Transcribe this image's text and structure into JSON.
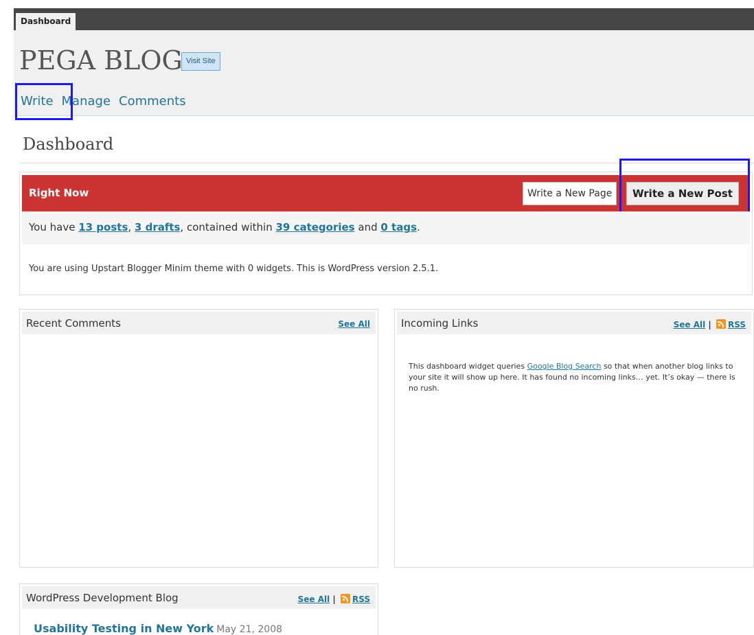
{
  "topbar": {
    "tab": "Dashboard"
  },
  "header": {
    "blog_title": "PEGA BLOG",
    "visit_site": "Visit Site",
    "nav": [
      "Write",
      "Manage",
      "Comments"
    ]
  },
  "page_title": "Dashboard",
  "right_now": {
    "title": "Right Now",
    "write_page": "Write a New Page",
    "write_post": "Write a New Post",
    "summary_prefix": "You have ",
    "posts": "13 posts",
    "comma": ", ",
    "drafts": "3 drafts",
    "mid": ", contained within ",
    "categories": "39 categories",
    "and": " and ",
    "tags": "0 tags",
    "end": ".",
    "theme_line": "You are using Upstart Blogger Minim theme with 0 widgets. This is WordPress version 2.5.1."
  },
  "recent_comments": {
    "title": "Recent Comments",
    "see_all": "See All"
  },
  "incoming_links": {
    "title": "Incoming Links",
    "see_all": "See All",
    "sep": " | ",
    "rss": "RSS",
    "body_prefix": "This dashboard widget queries ",
    "link": "Google Blog Search",
    "body_suffix": " so that when another blog links to your site it will show up here. It has found no incoming links… yet. It’s okay — there is no rush."
  },
  "dev_blog": {
    "title": "WordPress Development Blog",
    "see_all": "See All",
    "sep": " | ",
    "rss": "RSS",
    "item_title": "Usability Testing in New York",
    "item_date": "May 21, 2008"
  },
  "colors": {
    "accent": "#cc3333",
    "link": "#21759b",
    "highlight": "#1a1af0"
  }
}
